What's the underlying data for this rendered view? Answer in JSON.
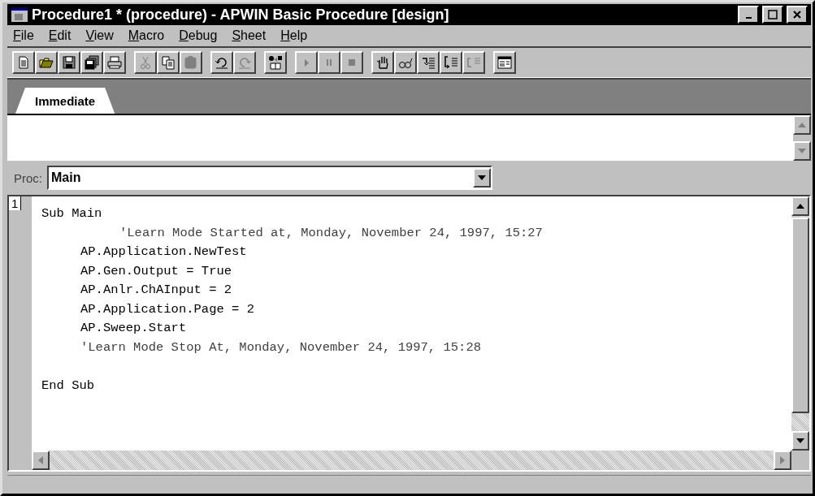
{
  "window": {
    "title": "Procedure1 * (procedure) - APWIN Basic Procedure [design]"
  },
  "menu": [
    {
      "label": "File"
    },
    {
      "label": "Edit"
    },
    {
      "label": "View"
    },
    {
      "label": "Macro"
    },
    {
      "label": "Debug"
    },
    {
      "label": "Sheet"
    },
    {
      "label": "Help"
    }
  ],
  "toolbar": [
    [
      {
        "kind": "new",
        "disabled": false
      },
      {
        "kind": "open",
        "disabled": false
      },
      {
        "kind": "save",
        "disabled": false
      },
      {
        "kind": "save-all",
        "disabled": false
      },
      {
        "kind": "print",
        "disabled": false
      }
    ],
    [
      {
        "kind": "cut",
        "disabled": true
      },
      {
        "kind": "copy",
        "disabled": false
      },
      {
        "kind": "paste",
        "disabled": true
      }
    ],
    [
      {
        "kind": "undo",
        "disabled": false
      },
      {
        "kind": "redo",
        "disabled": true
      }
    ],
    [
      {
        "kind": "dialog",
        "disabled": false
      }
    ],
    [
      {
        "kind": "run",
        "disabled": true
      },
      {
        "kind": "pause",
        "disabled": true
      },
      {
        "kind": "stop",
        "disabled": true
      }
    ],
    [
      {
        "kind": "hand",
        "disabled": false
      },
      {
        "kind": "glasses",
        "disabled": false
      },
      {
        "kind": "step-in",
        "disabled": false
      },
      {
        "kind": "step-over",
        "disabled": false
      },
      {
        "kind": "step-out",
        "disabled": true
      }
    ],
    [
      {
        "kind": "window",
        "disabled": false
      }
    ]
  ],
  "tabs": [
    {
      "label": "Immediate",
      "selected": true
    }
  ],
  "proc": {
    "label": "Proc:",
    "value": "Main"
  },
  "editor": {
    "line_number": "1",
    "lines": [
      {
        "kind": "block",
        "text": "Sub Main"
      },
      {
        "kind": "deep-comment",
        "text": "'Learn Mode Started at, Monday, November 24, 1997, 15:27"
      },
      {
        "kind": "statement",
        "text": "AP.Application.NewTest"
      },
      {
        "kind": "statement",
        "text": "AP.Gen.Output = True"
      },
      {
        "kind": "statement",
        "text": "AP.Anlr.ChAInput = 2"
      },
      {
        "kind": "statement",
        "text": "AP.Application.Page = 2"
      },
      {
        "kind": "statement",
        "text": "AP.Sweep.Start"
      },
      {
        "kind": "comment",
        "text": "'Learn Mode Stop At, Monday, November 24, 1997, 15:28"
      },
      {
        "kind": "blank"
      },
      {
        "kind": "block",
        "text": "End Sub"
      }
    ]
  }
}
